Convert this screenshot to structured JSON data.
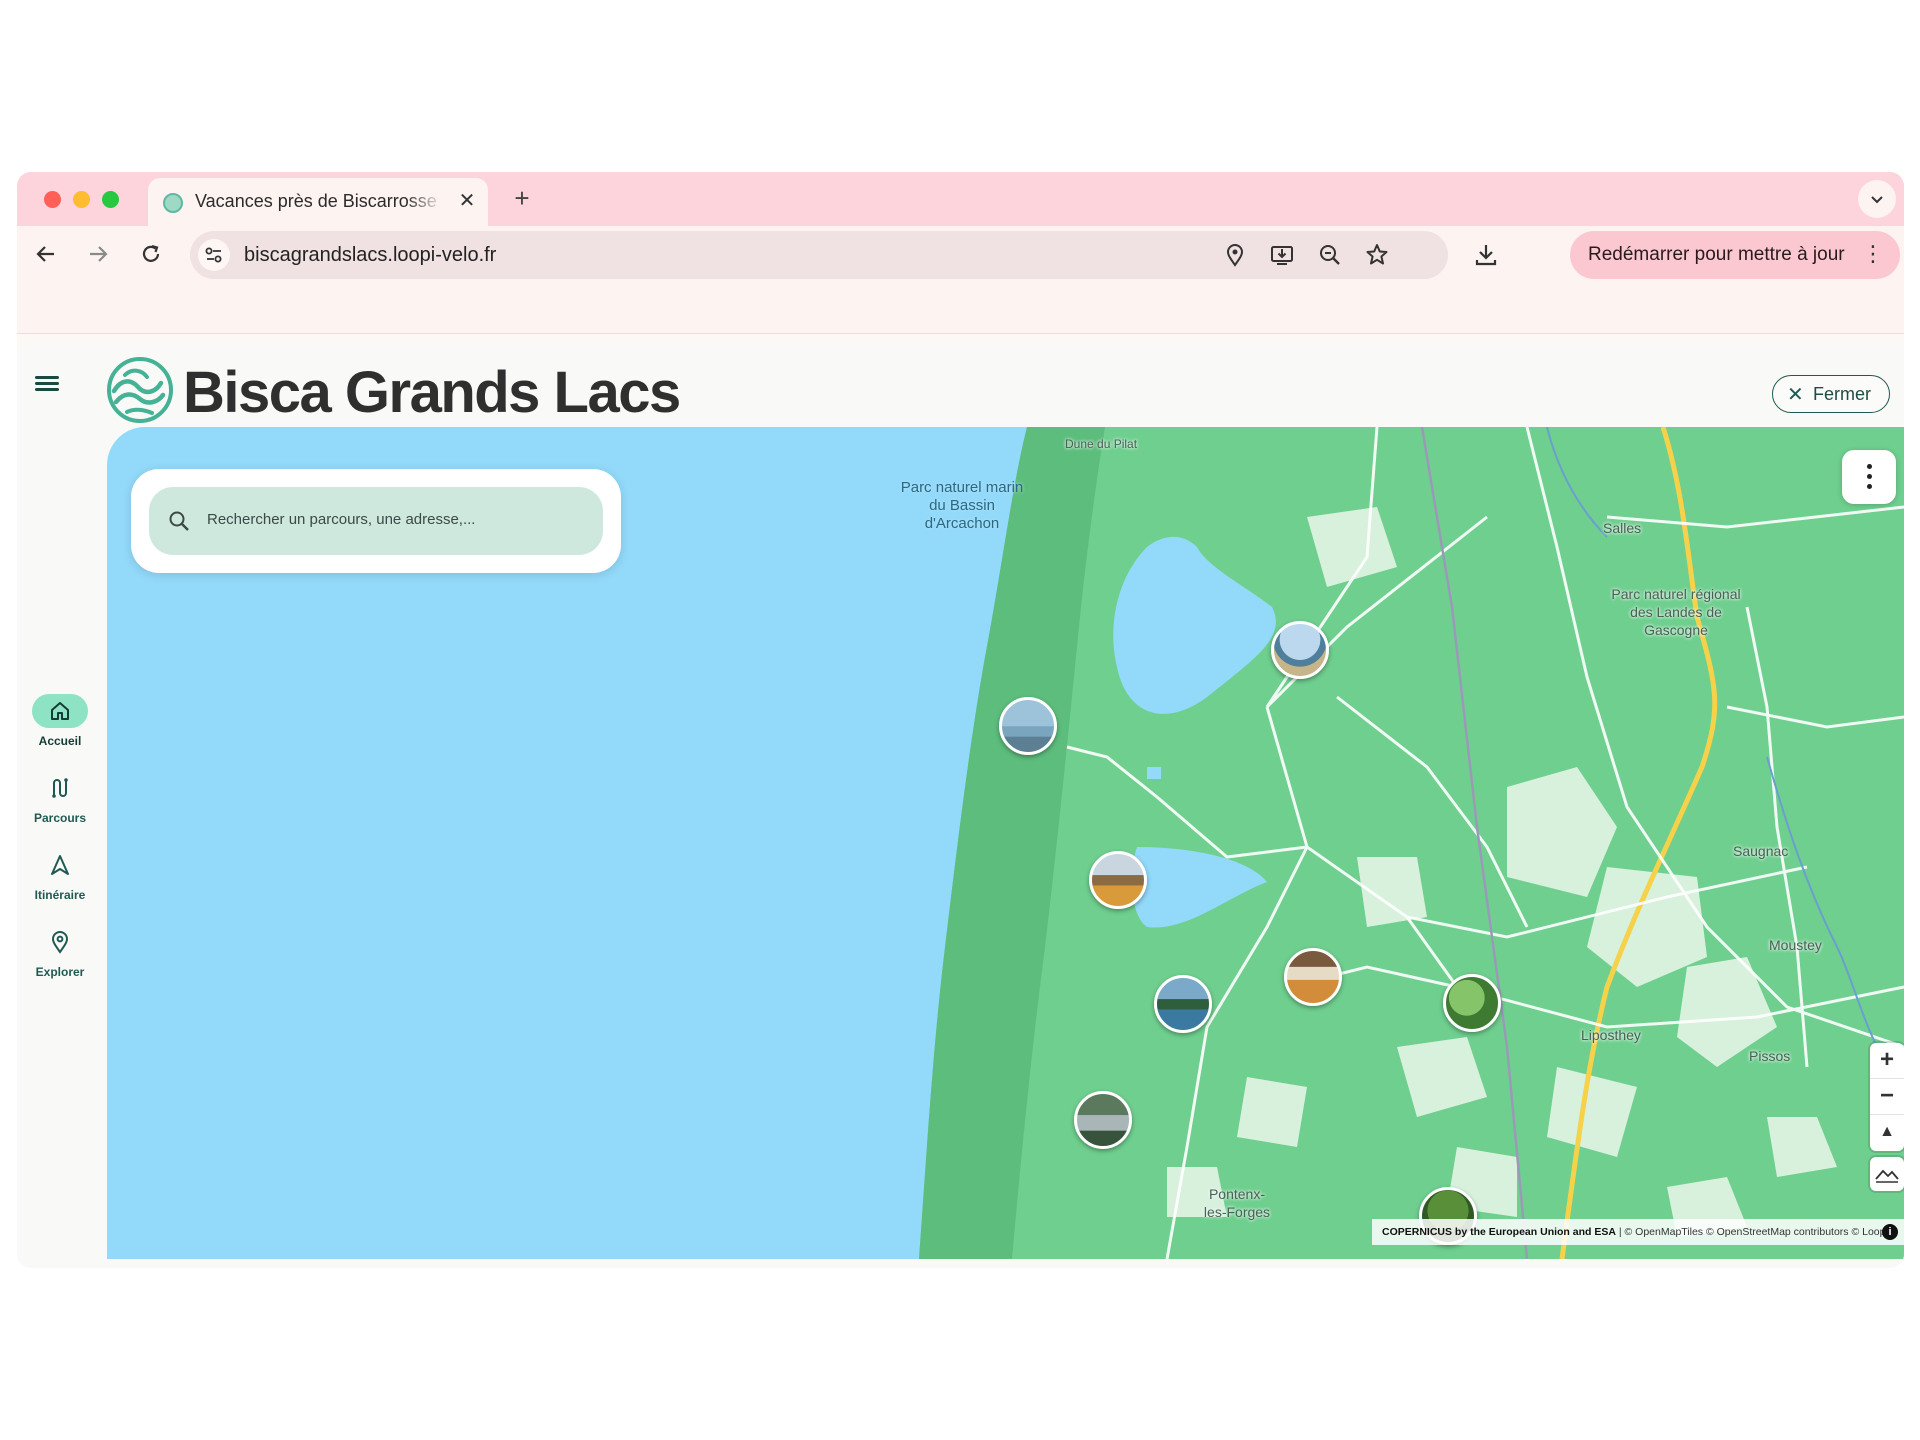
{
  "browser": {
    "tab_title": "Vacances près de Biscarrosse",
    "tab_close": "✕",
    "new_tab": "+",
    "url": "biscagrandslacs.loopi-velo.fr",
    "update_button": "Redémarrer pour mettre à jour"
  },
  "header": {
    "brand": "Bisca Grands Lacs",
    "close_label": "Fermer",
    "close_icon": "✕"
  },
  "rail": {
    "items": [
      {
        "label": "Accueil",
        "icon": "home-icon",
        "active": true
      },
      {
        "label": "Parcours",
        "icon": "route-icon",
        "active": false
      },
      {
        "label": "Itinéraire",
        "icon": "navigation-icon",
        "active": false
      },
      {
        "label": "Explorer",
        "icon": "location-pin-icon",
        "active": false
      }
    ]
  },
  "map": {
    "search_placeholder": "Rechercher un parcours, une adresse,...",
    "labels": {
      "dune": "Dune du Pilat",
      "parc_marin": "Parc naturel marin du Bassin d'Arcachon",
      "salles": "Salles",
      "parc_landes": "Parc naturel régional des Landes de Gascogne",
      "saugnac": "Saugnac",
      "moustey": "Moustey",
      "liposthey": "Liposthey",
      "pissos": "Pissos",
      "pontenx": "Pontenx-les-Forges"
    },
    "zoom_in": "+",
    "zoom_out": "−",
    "compass": "▲",
    "attribution_bold": "COPERNICUS by the European Union and ESA",
    "attribution_rest": " | © OpenMapTiles © OpenStreetMap contributors © Loopi",
    "info": "i"
  },
  "colors": {
    "accent": "#1f5a52",
    "active_rail": "#8ee3c4",
    "sea": "#93d9fa",
    "land": "#6fcf8f",
    "tab_bar": "#fdd3dc"
  }
}
